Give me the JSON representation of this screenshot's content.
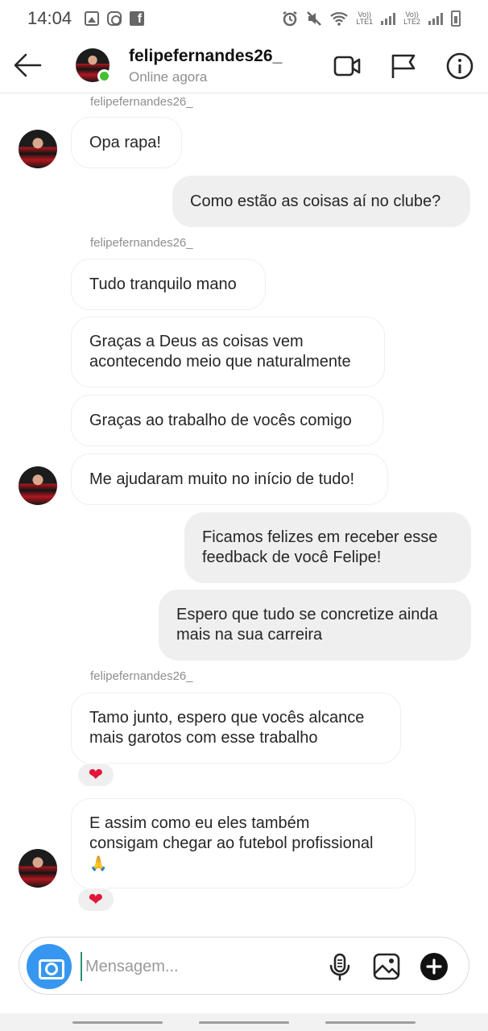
{
  "status_bar": {
    "time": "14:04",
    "icons": [
      "image-icon",
      "instagram-icon",
      "facebook-icon",
      "alarm-icon",
      "mute-icon",
      "wifi-icon",
      "signal-icon",
      "battery-icon"
    ],
    "net1_top": "Vo))",
    "net1_bottom": "LTE1",
    "net2_top": "Vo))",
    "net2_bottom": "LTE2"
  },
  "header": {
    "username": "felipefernandes26_",
    "status": "Online agora",
    "online_color": "#44c133"
  },
  "messages": [
    {
      "sender_label": "felipefernandes26_"
    },
    {
      "direction": "in",
      "text": "Opa rapa!"
    },
    {
      "direction": "out",
      "text": "Como estão as coisas aí no clube?"
    },
    {
      "sender_label": "felipefernandes26_"
    },
    {
      "direction": "in",
      "text": "Tudo tranquilo mano"
    },
    {
      "direction": "in",
      "line1": "Graças a Deus as coisas vem",
      "line2": "acontecendo meio que naturalmente"
    },
    {
      "direction": "in",
      "text": "Graças ao trabalho de vocês comigo"
    },
    {
      "direction": "in",
      "text": "Me ajudaram muito no início de tudo!"
    },
    {
      "direction": "out",
      "line1": "Ficamos felizes em receber esse",
      "line2": "feedback de você Felipe!"
    },
    {
      "direction": "out",
      "line1": "Espero que tudo se concretize ainda",
      "line2": "mais na sua carreira"
    },
    {
      "sender_label": "felipefernandes26_"
    },
    {
      "direction": "in",
      "line1": "Tamo junto, espero que vocês alcance",
      "line2": "mais garotos com esse trabalho",
      "reaction": "❤"
    },
    {
      "direction": "in",
      "line1": "E assim como eu eles também",
      "line2": "consigam chegar ao futebol profissional",
      "line3": "🙏",
      "reaction": "❤"
    }
  ],
  "composer": {
    "placeholder": "Mensagem...",
    "accent": "#3797f0"
  }
}
